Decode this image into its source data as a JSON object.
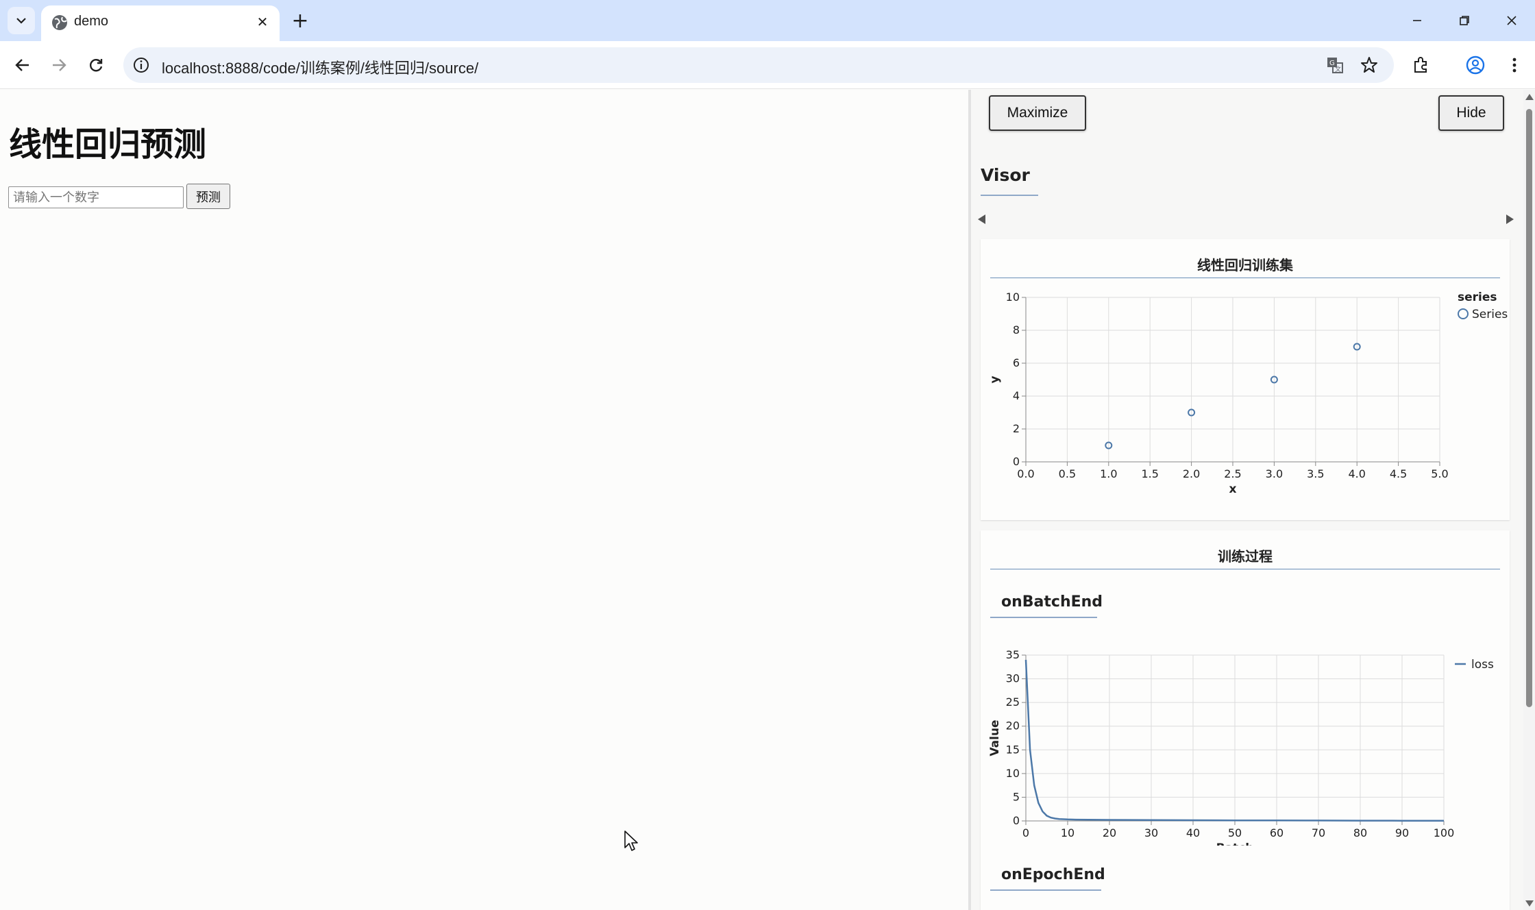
{
  "browser": {
    "tab": {
      "title": "demo"
    },
    "address_bar": {
      "url": "localhost:8888/code/训练案例/线性回归/source/"
    },
    "icons": [
      "tab-search-icon",
      "globe-icon",
      "close-icon",
      "plus-icon",
      "minimize-icon",
      "restore-icon",
      "close-window-icon",
      "back-arrow-icon",
      "forward-arrow-icon",
      "reload-icon",
      "site-info-icon",
      "translate-icon",
      "star-icon",
      "extensions-icon",
      "profile-icon",
      "more-menu-icon"
    ]
  },
  "page": {
    "heading": "线性回归预测",
    "input": {
      "placeholder": "请输入一个数字",
      "value": ""
    },
    "predict_button": "预测"
  },
  "visor": {
    "maximize_button": "Maximize",
    "hide_button": "Hide",
    "title": "Visor",
    "train_card": {
      "title": "线性回归训练集"
    },
    "process_card": {
      "title": "训练过程",
      "batch_section": "onBatchEnd",
      "epoch_section": "onEpochEnd"
    },
    "colors": {
      "accent": "#4c78a8",
      "rule": "#6a8fb8"
    }
  },
  "chart_data": [
    {
      "type": "scatter",
      "title": "线性回归训练集",
      "xlabel": "x",
      "ylabel": "y",
      "xlim": [
        0,
        5
      ],
      "ylim": [
        0,
        10
      ],
      "x_ticks": [
        "0.0",
        "0.5",
        "1.0",
        "1.5",
        "2.0",
        "2.5",
        "3.0",
        "3.5",
        "4.0",
        "4.5",
        "5.0"
      ],
      "y_ticks": [
        "0",
        "2",
        "4",
        "6",
        "8",
        "10"
      ],
      "legend_title": "series",
      "legend_position": "right",
      "grid": true,
      "series": [
        {
          "name": "Series",
          "points": [
            [
              1,
              1
            ],
            [
              2,
              3
            ],
            [
              3,
              5
            ],
            [
              4,
              7
            ]
          ]
        }
      ]
    },
    {
      "type": "line",
      "xlabel": "Batch",
      "ylabel": "Value",
      "xlim": [
        0,
        100
      ],
      "ylim": [
        0,
        35
      ],
      "x_ticks": [
        "0",
        "10",
        "20",
        "30",
        "40",
        "50",
        "60",
        "70",
        "80",
        "90",
        "100"
      ],
      "y_ticks": [
        "0",
        "5",
        "10",
        "15",
        "20",
        "25",
        "30",
        "35"
      ],
      "legend_position": "right",
      "grid": true,
      "series": [
        {
          "name": "loss",
          "x": [
            0,
            1,
            2,
            3,
            4,
            5,
            6,
            7,
            8,
            10,
            12,
            15,
            20,
            30,
            40,
            50,
            60,
            70,
            80,
            90,
            100
          ],
          "y": [
            34,
            15,
            7.5,
            3.8,
            2.0,
            1.1,
            0.7,
            0.5,
            0.4,
            0.32,
            0.28,
            0.25,
            0.22,
            0.18,
            0.15,
            0.12,
            0.1,
            0.08,
            0.06,
            0.05,
            0.04
          ]
        }
      ]
    }
  ]
}
